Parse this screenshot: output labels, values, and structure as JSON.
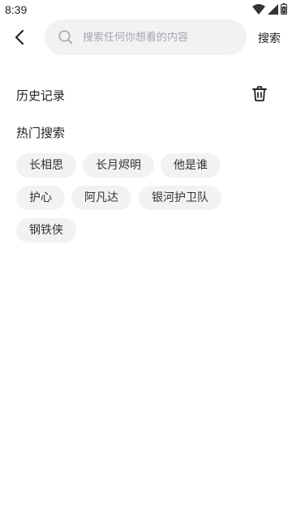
{
  "status_bar": {
    "time": "8:39"
  },
  "header": {
    "search_placeholder": "搜索任何你想看的内容",
    "search_button_label": "搜索"
  },
  "history": {
    "title": "历史记录"
  },
  "hot_search": {
    "title": "热门搜索",
    "tags": [
      "长相思",
      "长月烬明",
      "他是谁",
      "护心",
      "阿凡达",
      "银河护卫队",
      "钢铁侠"
    ]
  },
  "colors": {
    "chip_background": "#f1f2f4",
    "placeholder": "#a6a7ab",
    "text": "#222222"
  }
}
